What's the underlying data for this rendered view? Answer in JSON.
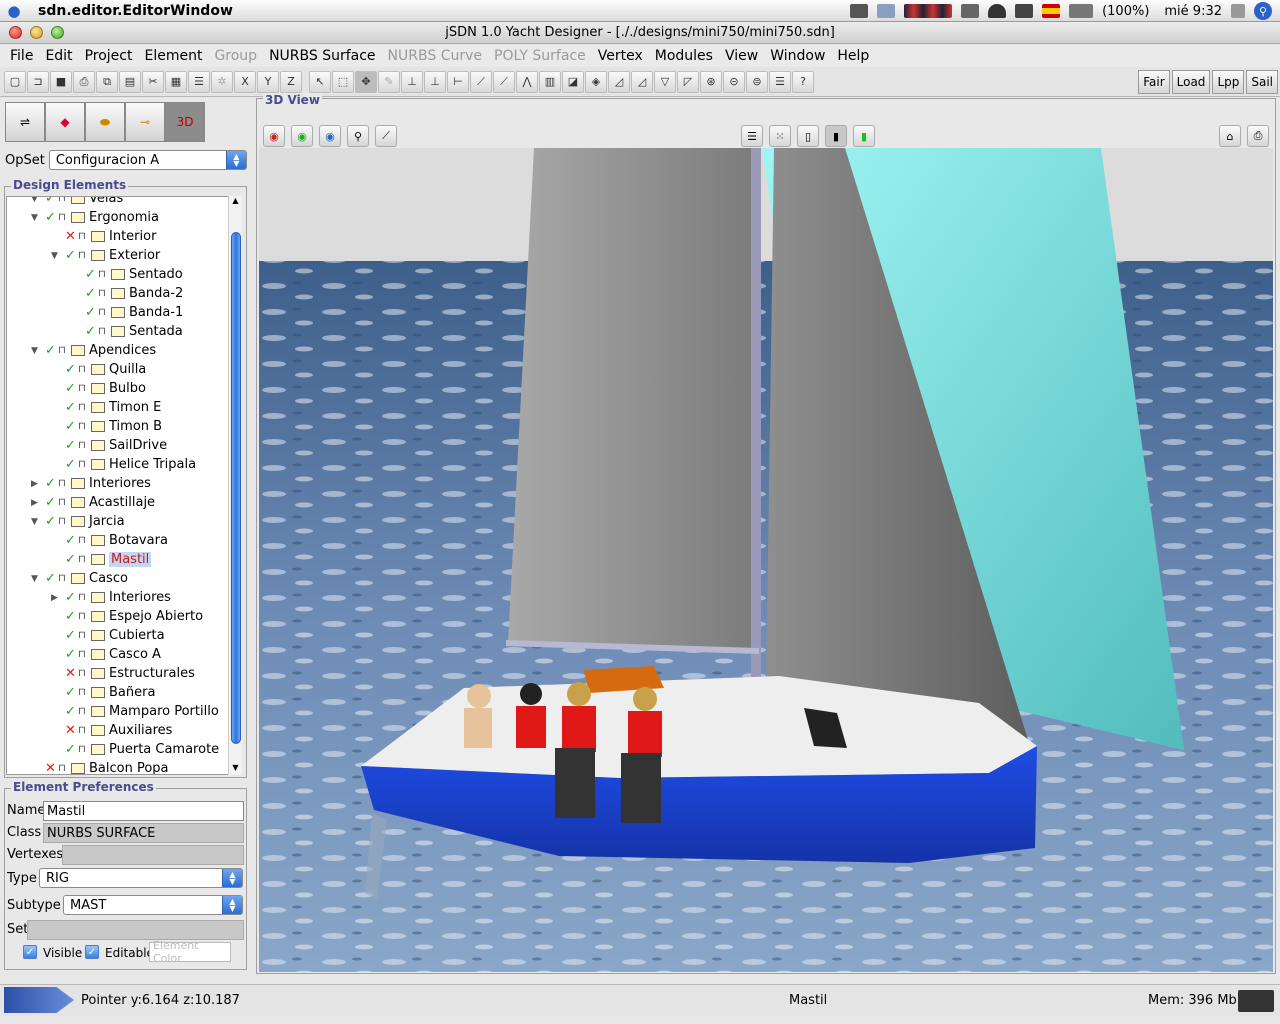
{
  "os_menubar": {
    "app_name": "sdn.editor.EditorWindow",
    "battery": "(100%)",
    "clock": "mié 9:32"
  },
  "window": {
    "title": "jSDN 1.0 Yacht Designer - [././designs/mini750/mini750.sdn]"
  },
  "menu": [
    {
      "label": "File",
      "enabled": true
    },
    {
      "label": "Edit",
      "enabled": true
    },
    {
      "label": "Project",
      "enabled": true
    },
    {
      "label": "Element",
      "enabled": true
    },
    {
      "label": "Group",
      "enabled": false
    },
    {
      "label": "NURBS Surface",
      "enabled": true
    },
    {
      "label": "NURBS Curve",
      "enabled": false
    },
    {
      "label": "POLY Surface",
      "enabled": false
    },
    {
      "label": "Vertex",
      "enabled": true
    },
    {
      "label": "Modules",
      "enabled": true
    },
    {
      "label": "View",
      "enabled": true
    },
    {
      "label": "Window",
      "enabled": true
    },
    {
      "label": "Help",
      "enabled": true
    }
  ],
  "toolbar": {
    "right_buttons": [
      "Fair",
      "Load",
      "Lpp",
      "Sail"
    ]
  },
  "left": {
    "opset_label": "OpSet",
    "opset_value": "Configuracion A",
    "design_elements_title": "Design Elements",
    "tree": [
      {
        "label": "Velas",
        "level": 1,
        "check": "ok",
        "twisty": "open"
      },
      {
        "label": "Ergonomia",
        "level": 1,
        "check": "ok",
        "twisty": "open"
      },
      {
        "label": "Interior",
        "level": 2,
        "check": "no",
        "twisty": ""
      },
      {
        "label": "Exterior",
        "level": 2,
        "check": "ok",
        "twisty": "open"
      },
      {
        "label": "Sentado",
        "level": 3,
        "check": "ok",
        "twisty": ""
      },
      {
        "label": "Banda-2",
        "level": 3,
        "check": "ok",
        "twisty": ""
      },
      {
        "label": "Banda-1",
        "level": 3,
        "check": "ok",
        "twisty": ""
      },
      {
        "label": "Sentada",
        "level": 3,
        "check": "ok",
        "twisty": ""
      },
      {
        "label": "Apendices",
        "level": 1,
        "check": "ok",
        "twisty": "open"
      },
      {
        "label": "Quilla",
        "level": 2,
        "check": "ok",
        "twisty": ""
      },
      {
        "label": "Bulbo",
        "level": 2,
        "check": "ok",
        "twisty": ""
      },
      {
        "label": "Timon E",
        "level": 2,
        "check": "ok",
        "twisty": ""
      },
      {
        "label": "Timon B",
        "level": 2,
        "check": "ok",
        "twisty": ""
      },
      {
        "label": "SailDrive",
        "level": 2,
        "check": "ok",
        "twisty": ""
      },
      {
        "label": "Helice Tripala",
        "level": 2,
        "check": "ok",
        "twisty": ""
      },
      {
        "label": "Interiores",
        "level": 1,
        "check": "ok",
        "twisty": "closed"
      },
      {
        "label": "Acastillaje",
        "level": 1,
        "check": "ok",
        "twisty": "closed"
      },
      {
        "label": "Jarcia",
        "level": 1,
        "check": "ok",
        "twisty": "open"
      },
      {
        "label": "Botavara",
        "level": 2,
        "check": "ok",
        "twisty": ""
      },
      {
        "label": "Mastil",
        "level": 2,
        "check": "ok",
        "twisty": "",
        "selected": true
      },
      {
        "label": "Casco",
        "level": 1,
        "check": "ok",
        "twisty": "open"
      },
      {
        "label": "Interiores",
        "level": 2,
        "check": "ok",
        "twisty": "closed"
      },
      {
        "label": "Espejo Abierto",
        "level": 2,
        "check": "ok",
        "twisty": ""
      },
      {
        "label": "Cubierta",
        "level": 2,
        "check": "ok",
        "twisty": ""
      },
      {
        "label": "Casco A",
        "level": 2,
        "check": "ok",
        "twisty": ""
      },
      {
        "label": "Estructurales",
        "level": 2,
        "check": "no",
        "twisty": ""
      },
      {
        "label": "Bañera",
        "level": 2,
        "check": "ok",
        "twisty": ""
      },
      {
        "label": "Mamparo Portillo",
        "level": 2,
        "check": "ok",
        "twisty": ""
      },
      {
        "label": "Auxiliares",
        "level": 2,
        "check": "no",
        "twisty": ""
      },
      {
        "label": "Puerta Camarote",
        "level": 2,
        "check": "ok",
        "twisty": ""
      },
      {
        "label": "Balcon Popa",
        "level": 1,
        "check": "no",
        "twisty": ""
      }
    ],
    "prefs": {
      "title": "Element Preferences",
      "name_label": "Name",
      "name_value": "Mastil",
      "class_label": "Class",
      "class_value": "NURBS SURFACE",
      "vertexes_label": "Vertexes",
      "type_label": "Type",
      "type_value": "RIG",
      "subtype_label": "Subtype",
      "subtype_value": "MAST",
      "set_label": "Set",
      "visible_label": "Visible",
      "editable_label": "Editable",
      "color_button": "Element Color"
    }
  },
  "view": {
    "title": "3D View"
  },
  "status": {
    "pointer": "Pointer y:6.164 z:10.187",
    "selection": "Mastil",
    "memory": "Mem: 396 Mb"
  },
  "colors": {
    "hull_blue": "#1b45d8",
    "jib_cyan": "#8ff0ee",
    "sail_gray": "#8d8d8d",
    "sea": "#5a7ba6",
    "sky": "#dcdcdc",
    "accent": "#3a75dc"
  }
}
